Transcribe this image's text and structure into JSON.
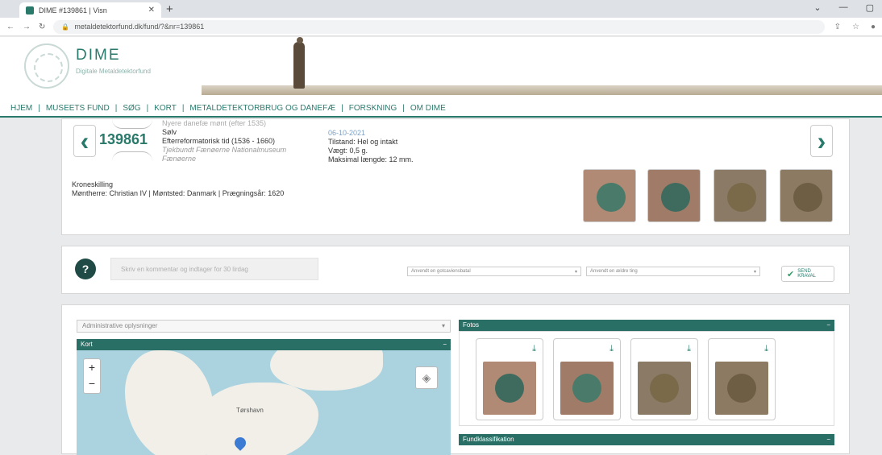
{
  "browser": {
    "tab_title": "DIME #139861 | Visn",
    "new_tab": "+",
    "url": "metaldetektorfund.dk/fund/?&nr=139861",
    "window_controls": [
      "⌄",
      "—",
      "▢"
    ]
  },
  "site": {
    "name": "DIME",
    "subtitle": "Digitale Metaldetektorfund"
  },
  "nav": {
    "items": [
      "HJEM",
      "MUSEETS FUND",
      "SØG",
      "KORT",
      "METALDETEKTORBRUG OG DANEFÆ",
      "FORSKNING",
      "OM DIME"
    ],
    "separator": "|"
  },
  "find": {
    "number": "139861",
    "prev_arrow": "‹",
    "next_arrow": "›",
    "header_line": "Nyere danefæ mønt (efter 1535)",
    "material": "Sølv",
    "period": "Efterreformatorisk tid (1536 - 1660)",
    "owner": "Tjekbundt Fænøerne Nationalmuseum",
    "place": "Fænøerne",
    "date": "06-10-2021",
    "condition": "Tilstand: Hel og intakt",
    "weight": "Vægt: 0,5 g.",
    "length": "Maksimal længde: 12 mm.",
    "coin_name": "Kroneskilling",
    "coin_details": "Møntherre: Christian IV | Møntsted: Danmark | Prægningsår: 1620",
    "thumb_colors": [
      "#4a7a6a",
      "#3f6a5e",
      "#7a6a4a",
      "#6e5e44"
    ]
  },
  "comment": {
    "help_icon": "?",
    "placeholder": "Skriv en kommentar og indtager for 30 lirdag",
    "select1": "Anvendt en gotcaviensbatal",
    "select2": "Anvendt en ældre ting",
    "send_label": "SEND KRAVAL"
  },
  "lower": {
    "admin_select": "Administrative oplysninger",
    "kort_title": "Kort",
    "zoom_in": "+",
    "zoom_out": "−",
    "map_label": "Tørshavn",
    "fotos_title": "Fotos",
    "collapse": "−",
    "dropdown_caret": "▾",
    "download_icon": "⤓",
    "photo_colors": [
      "#3f6a5e",
      "#4a7a6a",
      "#7a6a4a",
      "#6e5e44"
    ],
    "fund_title": "Fundklassifikation"
  }
}
